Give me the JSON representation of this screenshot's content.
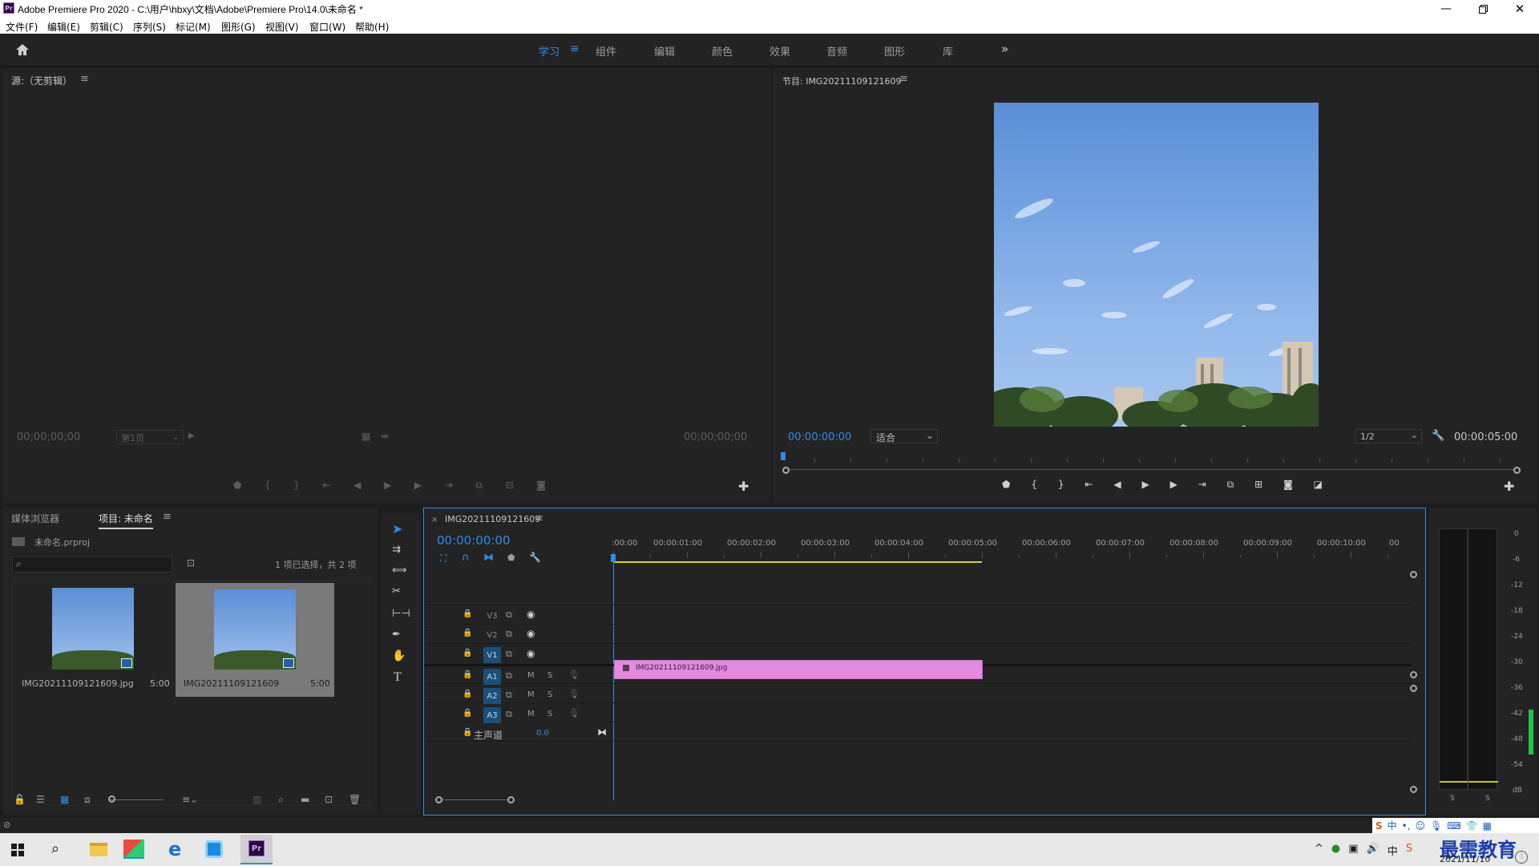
{
  "window": {
    "title": "Adobe Premiere Pro 2020 - C:\\用户\\hbxy\\文档\\Adobe\\Premiere Pro\\14.0\\未命名 *"
  },
  "menu": [
    "文件(F)",
    "编辑(E)",
    "剪辑(C)",
    "序列(S)",
    "标记(M)",
    "图形(G)",
    "视图(V)",
    "窗口(W)",
    "帮助(H)"
  ],
  "workspaces": [
    "学习",
    "组件",
    "编辑",
    "颜色",
    "效果",
    "音频",
    "图形",
    "库"
  ],
  "workspace_active": "学习",
  "source": {
    "title": "源:（无剪辑）",
    "tc_left": "00;00;00;00",
    "page": "第1页",
    "tc_right": "00;00;00;00"
  },
  "program": {
    "title": "节目: IMG20211109121609",
    "tc_current": "00:00:00:00",
    "fit": "适合",
    "res": "1/2",
    "tc_duration": "00:00:05:00"
  },
  "project": {
    "tabs": [
      "媒体浏览器",
      "项目: 未命名"
    ],
    "active_tab": "项目: 未命名",
    "file": "未命名.prproj",
    "search_placeholder": "",
    "selection": "1 项已选择，共 2 项",
    "items": [
      {
        "name": "IMG20211109121609.jpg",
        "dur": "5:00"
      },
      {
        "name": "IMG20211109121609",
        "dur": "5:00"
      }
    ]
  },
  "timeline": {
    "tab": "IMG20211109121609",
    "tc": "00:00:00:00",
    "ruler": [
      ":00:00",
      "00:00:01:00",
      "00:00:02:00",
      "00:00:03:00",
      "00:00:04:00",
      "00:00:05:00",
      "00:00:06:00",
      "00:00:07:00",
      "00:00:08:00",
      "00:00:09:00",
      "00:00:10:00",
      "00"
    ],
    "video_tracks": [
      "V3",
      "V2",
      "V1"
    ],
    "audio_tracks": [
      "A1",
      "A2",
      "A3"
    ],
    "mute_label": "M",
    "solo_label": "S",
    "master_label": "主声道",
    "master_value": "0.0",
    "clip_name": "IMG20211109121609.jpg"
  },
  "meter": {
    "scale": [
      "0",
      "-6",
      "-12",
      "-18",
      "-24",
      "-30",
      "-36",
      "-42",
      "-48",
      "-54",
      "dB"
    ],
    "solo": [
      "S",
      "S"
    ]
  },
  "taskbar": {
    "date": "2021/11/10",
    "ime": "中",
    "watermark": "最需教育"
  },
  "colors": {
    "accent": "#2d8ceb",
    "clip": "#e38ae0",
    "workarea": "#d7d03a",
    "panel": "#232323"
  }
}
